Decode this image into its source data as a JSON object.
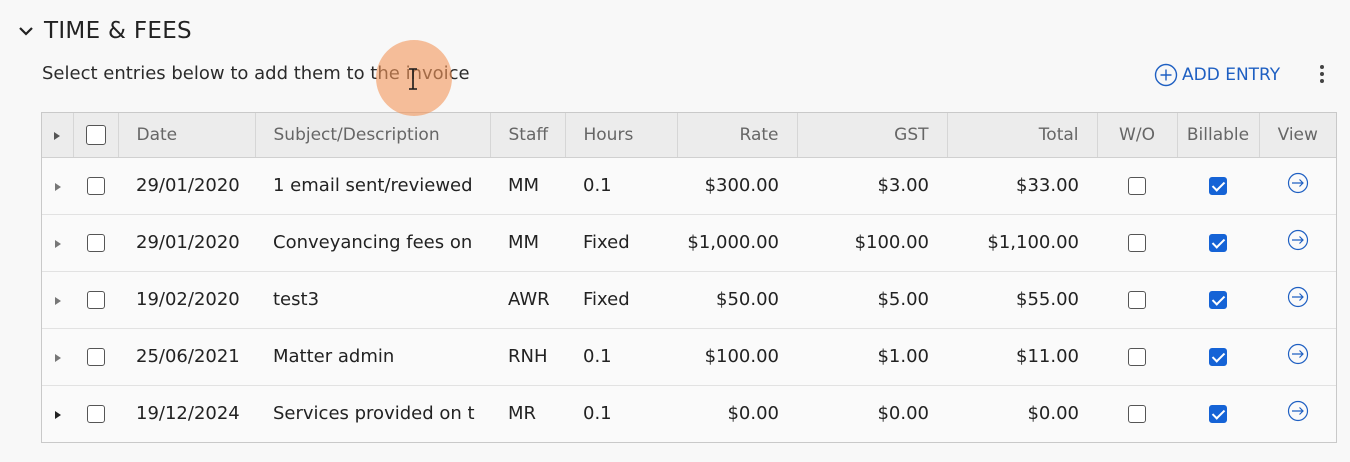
{
  "section": {
    "title": "TIME & FEES",
    "toggle_icon": "chevron-down-icon"
  },
  "subtitle": "Select entries below to add them to the invoice",
  "toolbar": {
    "add_entry_label": "ADD ENTRY",
    "add_icon": "plus-circle-icon",
    "more_icon": "kebab-menu-icon"
  },
  "table": {
    "columns": [
      "",
      "",
      "Date",
      "Subject/Description",
      "Staff",
      "Hours",
      "Rate",
      "GST",
      "Total",
      "W/O",
      "Billable",
      "View"
    ],
    "rows": [
      {
        "date": "29/01/2020",
        "subject": "1 email sent/reviewed",
        "staff": "MM",
        "hours": "0.1",
        "rate": "$300.00",
        "gst": "$3.00",
        "total": "$33.00",
        "wo": false,
        "billable": true
      },
      {
        "date": "29/01/2020",
        "subject": "Conveyancing fees on",
        "staff": "MM",
        "hours": "Fixed",
        "rate": "$1,000.00",
        "gst": "$100.00",
        "total": "$1,100.00",
        "wo": false,
        "billable": true
      },
      {
        "date": "19/02/2020",
        "subject": "test3",
        "staff": "AWR",
        "hours": "Fixed",
        "rate": "$50.00",
        "gst": "$5.00",
        "total": "$55.00",
        "wo": false,
        "billable": true
      },
      {
        "date": "25/06/2021",
        "subject": "Matter admin",
        "staff": "RNH",
        "hours": "0.1",
        "rate": "$100.00",
        "gst": "$1.00",
        "total": "$11.00",
        "wo": false,
        "billable": true
      },
      {
        "date": "19/12/2024",
        "subject": "Services provided on t",
        "staff": "MR",
        "hours": "0.1",
        "rate": "$0.00",
        "gst": "$0.00",
        "total": "$0.00",
        "wo": false,
        "billable": true
      }
    ]
  },
  "colors": {
    "accent": "#1563d6",
    "link": "#1e5fc2",
    "header_bg": "#ececec",
    "cursor_highlight": "#f4965a"
  }
}
